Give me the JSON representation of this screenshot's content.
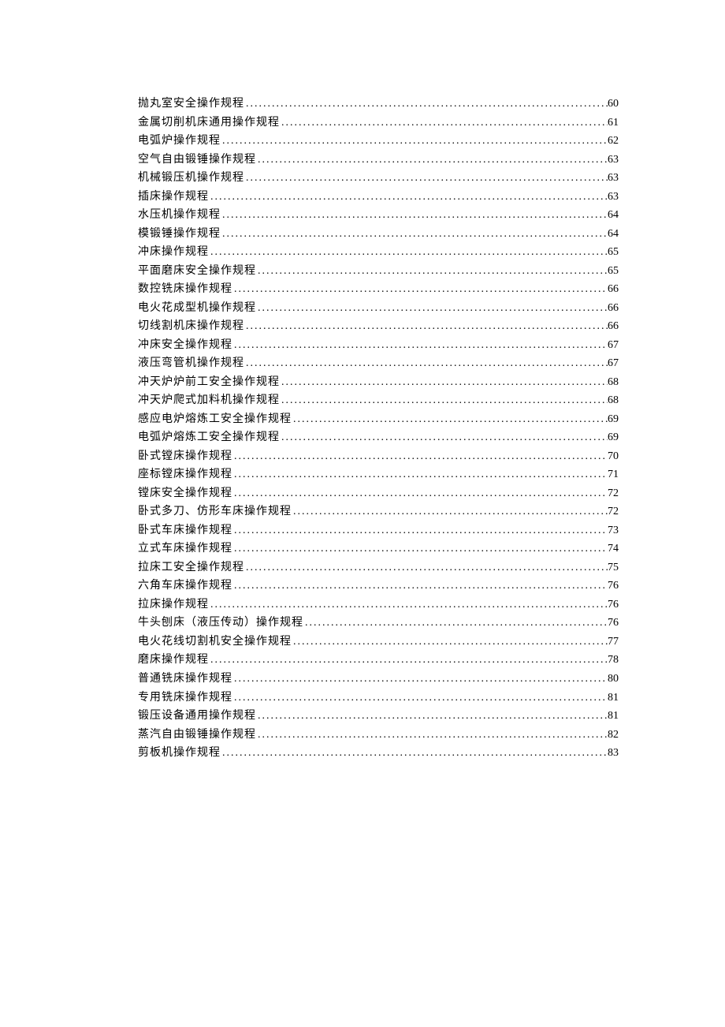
{
  "toc": [
    {
      "title": "抛丸室安全操作规程",
      "page": "60"
    },
    {
      "title": "金属切削机床通用操作规程",
      "page": "61"
    },
    {
      "title": "电弧炉操作规程",
      "page": "62"
    },
    {
      "title": "空气自由锻锤操作规程",
      "page": "63"
    },
    {
      "title": "机械锻压机操作规程",
      "page": "63"
    },
    {
      "title": "插床操作规程",
      "page": "63"
    },
    {
      "title": "水压机操作规程",
      "page": "64"
    },
    {
      "title": "模锻锤操作规程",
      "page": "64"
    },
    {
      "title": "冲床操作规程",
      "page": "65"
    },
    {
      "title": "平面磨床安全操作规程",
      "page": "65"
    },
    {
      "title": "数控铣床操作规程",
      "page": "66"
    },
    {
      "title": "电火花成型机操作规程",
      "page": "66"
    },
    {
      "title": "切线割机床操作规程",
      "page": "66"
    },
    {
      "title": "冲床安全操作规程",
      "page": "67"
    },
    {
      "title": "液压弯管机操作规程",
      "page": "67"
    },
    {
      "title": "冲天炉炉前工安全操作规程",
      "page": "68"
    },
    {
      "title": "冲天炉爬式加料机操作规程",
      "page": "68"
    },
    {
      "title": "感应电炉熔炼工安全操作规程",
      "page": "69"
    },
    {
      "title": "电弧炉熔炼工安全操作规程",
      "page": "69"
    },
    {
      "title": "卧式镗床操作规程",
      "page": "70"
    },
    {
      "title": "座标镗床操作规程",
      "page": "71"
    },
    {
      "title": "镗床安全操作规程",
      "page": "72"
    },
    {
      "title": "卧式多刀、仿形车床操作规程",
      "page": "72"
    },
    {
      "title": "卧式车床操作规程",
      "page": "73"
    },
    {
      "title": "立式车床操作规程",
      "page": "74"
    },
    {
      "title": "拉床工安全操作规程",
      "page": "75"
    },
    {
      "title": "六角车床操作规程",
      "page": "76"
    },
    {
      "title": "拉床操作规程",
      "page": "76"
    },
    {
      "title": "牛头刨床（液压传动）操作规程",
      "page": "76"
    },
    {
      "title": "电火花线切割机安全操作规程",
      "page": "77"
    },
    {
      "title": "磨床操作规程",
      "page": "78"
    },
    {
      "title": "普通铣床操作规程",
      "page": "80"
    },
    {
      "title": "专用铣床操作规程",
      "page": "81"
    },
    {
      "title": "锻压设备通用操作规程",
      "page": "81"
    },
    {
      "title": "蒸汽自由锻锤操作规程",
      "page": "82"
    },
    {
      "title": "剪板机操作规程",
      "page": "83"
    }
  ]
}
